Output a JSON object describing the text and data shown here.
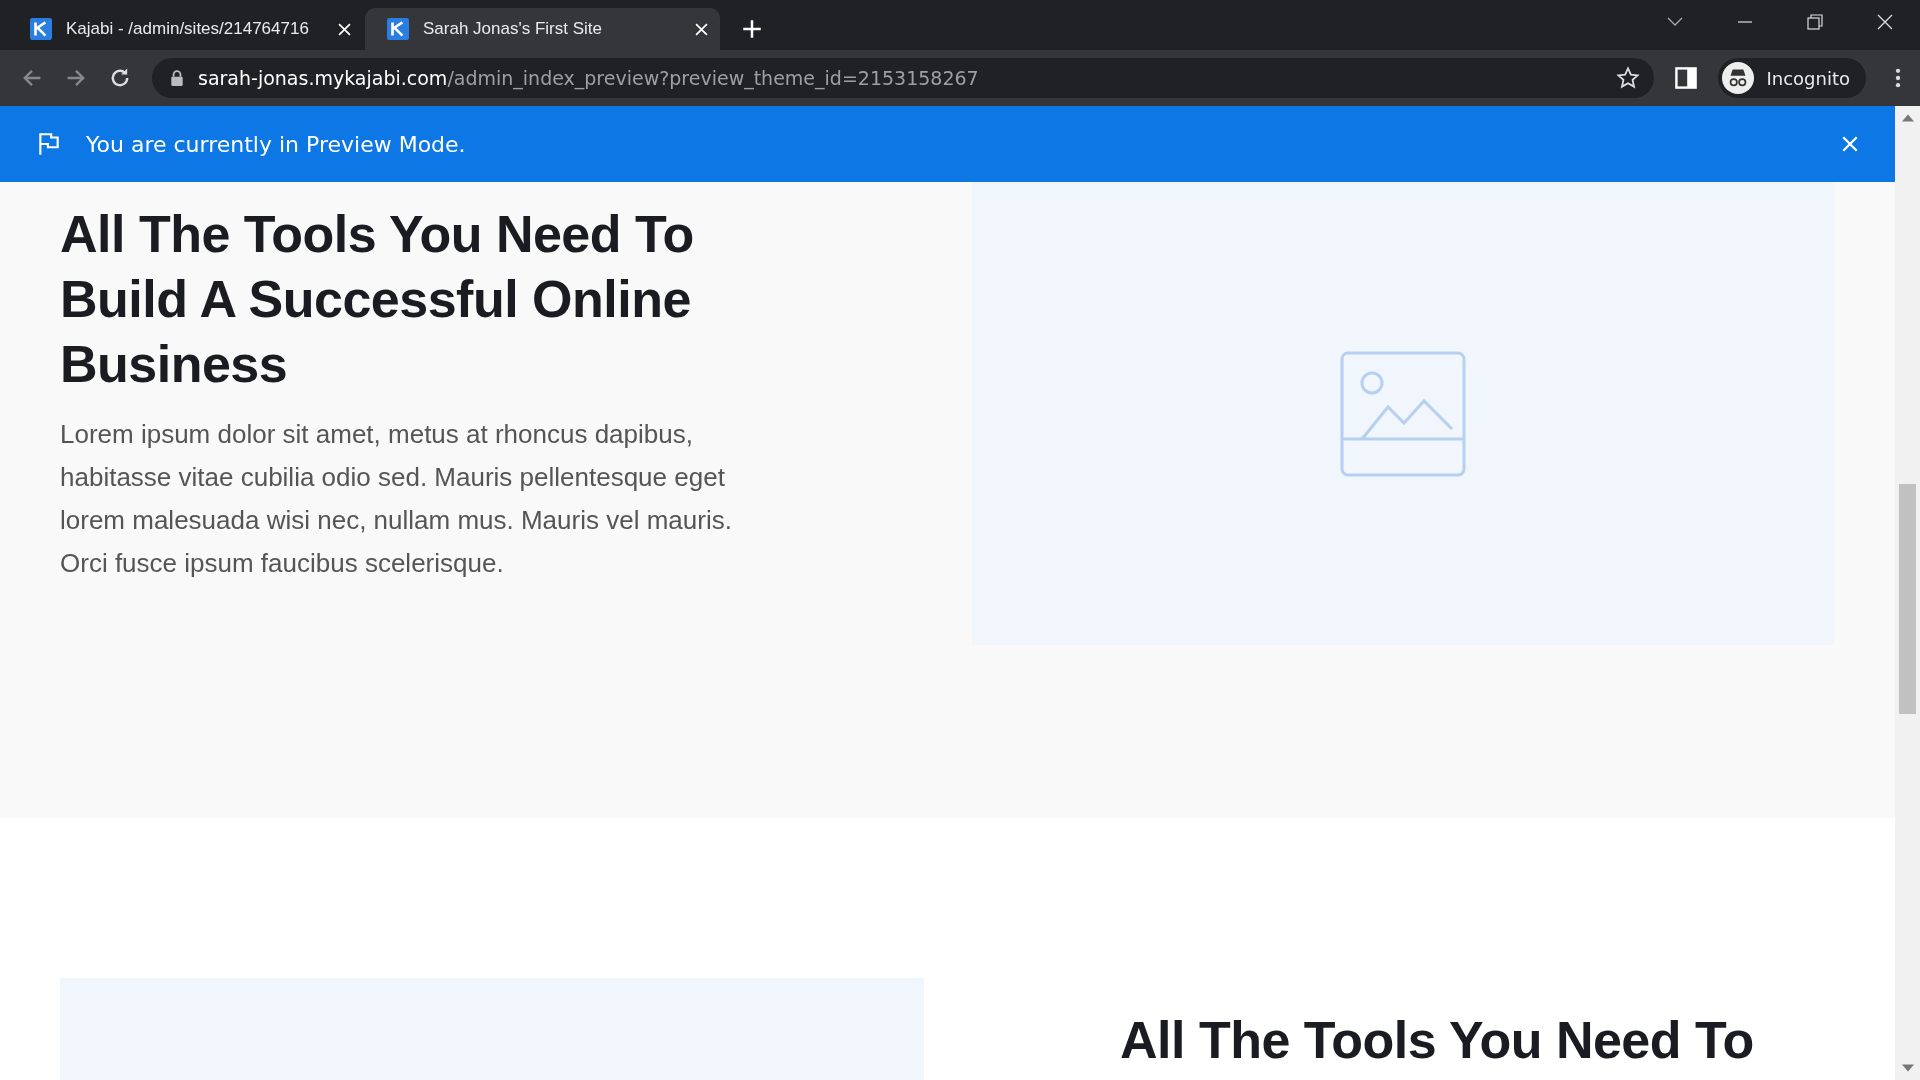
{
  "tabs": [
    {
      "title": "Kajabi - /admin/sites/214764716",
      "selected": false
    },
    {
      "title": "Sarah Jonas's First Site",
      "selected": true
    }
  ],
  "address_bar": {
    "host": "sarah-jonas.mykajabi.com",
    "path": "/admin_index_preview?preview_theme_id=2153158267"
  },
  "profile": {
    "label": "Incognito"
  },
  "banner": {
    "text": "You are currently in Preview Mode."
  },
  "sections": [
    {
      "heading": "All The Tools You Need To Build A Successful Online Business",
      "body": "Lorem ipsum dolor sit amet, metus at rhoncus dapibus, habitasse vitae cubilia odio sed. Mauris pellentesque eget lorem malesuada wisi nec, nullam mus. Mauris vel mauris. Orci fusce ipsum faucibus scelerisque."
    },
    {
      "heading": "All The Tools You Need To"
    }
  ]
}
